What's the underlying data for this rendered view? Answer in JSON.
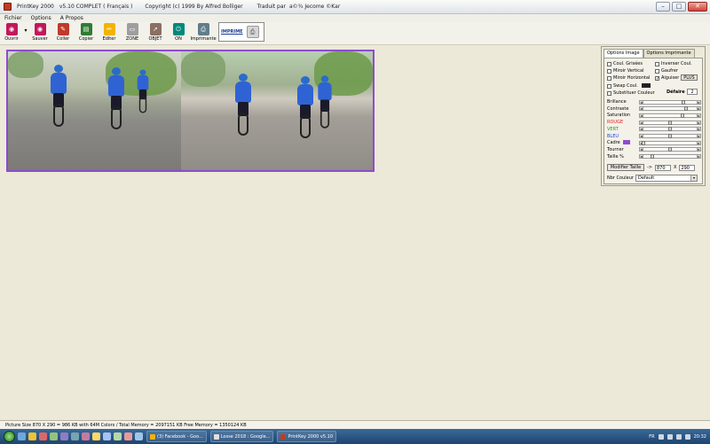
{
  "window": {
    "title_app": "PrintKey 2000",
    "title_version": "v5.10 COMPLET ( Français )",
    "title_copyright": "Copyright (c) 1999 By Alfred Bolliger",
    "title_translation": "Traduit par",
    "title_translator": "a©¾ Jecome ©Kar"
  },
  "menu": [
    "Fichier",
    "Options",
    "A Propos"
  ],
  "toolbar": {
    "tools": [
      {
        "label": "Ouvrir",
        "icon": "camera-icon",
        "color": "#c2185b"
      },
      {
        "label": "Sauver",
        "icon": "camera-icon",
        "color": "#c2185b"
      },
      {
        "label": "Coller",
        "icon": "brush-icon",
        "color": "#c0392b"
      },
      {
        "label": "Copier",
        "icon": "paste-icon",
        "color": "#2e7d32"
      },
      {
        "label": "Editer",
        "icon": "pencil-icon",
        "color": "#f2b400"
      },
      {
        "label": "ZONE",
        "icon": "page-icon",
        "color": "#9e9e9e"
      },
      {
        "label": "OBJET",
        "icon": "pointer-icon",
        "color": "#8d6e63"
      },
      {
        "label": "ON",
        "icon": "on-icon",
        "color": "#00897b"
      },
      {
        "label": "Imprimante",
        "icon": "printer-icon",
        "color": "#607d8b"
      }
    ],
    "imprime_label": "IMPRIME"
  },
  "options_panel": {
    "tabs": [
      "Options Image",
      "Options Imprimante"
    ],
    "checkboxes": [
      {
        "label": "Coul. Grisées",
        "checked": false
      },
      {
        "label": "Inverser Coul.",
        "checked": false
      },
      {
        "label": "Miroir Vertical",
        "checked": false
      },
      {
        "label": "Gaufrer",
        "checked": false
      },
      {
        "label": "Miroir Horizontal",
        "checked": false
      },
      {
        "label": "Aiguiser",
        "checked": true
      },
      {
        "label": "Swap Coul.",
        "checked": false
      },
      {
        "label": "Substituer Couleur",
        "checked": false
      }
    ],
    "plus_label": "PLUS",
    "defaire_label": "Défaire",
    "defaire_value": "2",
    "sliders": [
      {
        "label": "Brillance",
        "level": 0.72,
        "color": "#000000"
      },
      {
        "label": "Contraste",
        "level": 0.76,
        "color": "#000000"
      },
      {
        "label": "Saturation",
        "level": 0.7,
        "color": "#000000"
      },
      {
        "label": "ROUGE",
        "level": 0.5,
        "color": "#e02020"
      },
      {
        "label": "VERT",
        "level": 0.5,
        "color": "#20a020"
      },
      {
        "label": "BLEU",
        "level": 0.5,
        "color": "#2040e0"
      },
      {
        "label": "Cadre",
        "level": 0.06,
        "color": "#000000"
      },
      {
        "label": "Tourner",
        "level": 0.5,
        "color": "#000000"
      },
      {
        "label": "Taille %",
        "level": 0.2,
        "color": "#000000"
      }
    ],
    "modifier_label": "Modifier Taille",
    "arrow_text": "->",
    "width_value": "870",
    "x_text": "X",
    "height_value": "290",
    "nbr_label": "Nbr Couleur",
    "nbr_value": "Default"
  },
  "status": {
    "text": "Picture Size 870 X 290 =   986 KB with 64M Colors   /  Total Memory = 2097151 KB  Free Memory = 1350124 KB"
  },
  "taskbar": {
    "tasks": [
      {
        "label": "(3) Facebook - Goo..."
      },
      {
        "label": "Losse 2018 : Google..."
      },
      {
        "label": "PrintKey 2000 v5.10"
      }
    ],
    "lang": "FR",
    "clock": "20:32"
  }
}
